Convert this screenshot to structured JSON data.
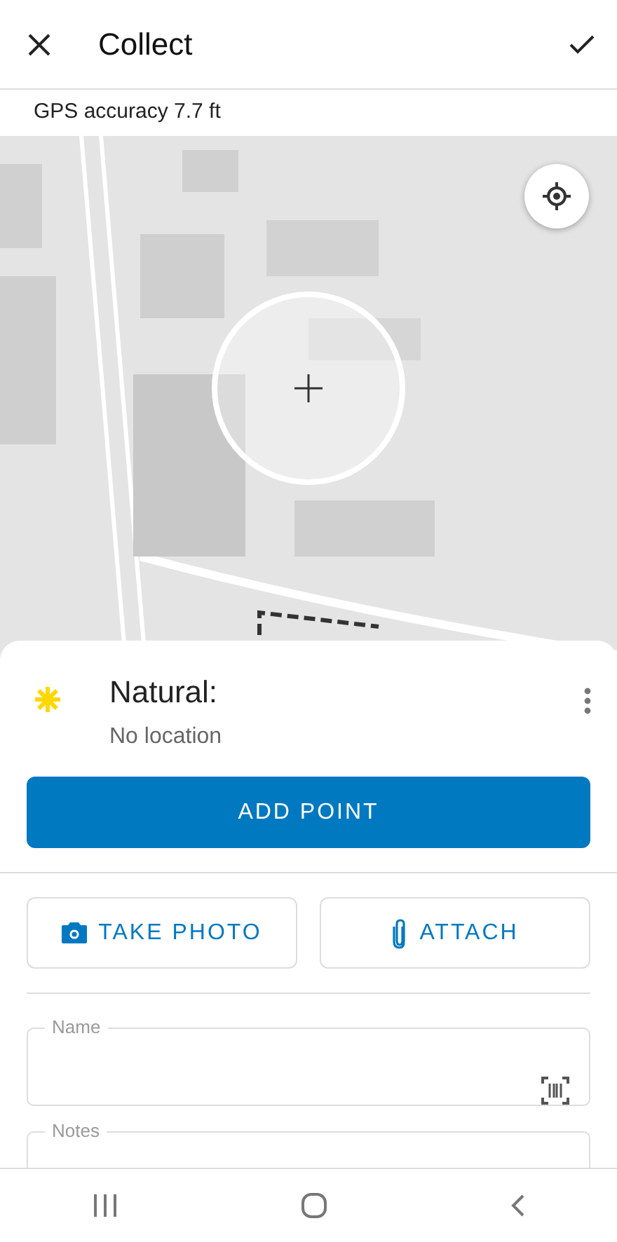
{
  "app_bar": {
    "title": "Collect"
  },
  "gps_status": "GPS accuracy 7.7 ft",
  "feature": {
    "title": "Natural:",
    "subtitle": "No location"
  },
  "primary_action": "ADD POINT",
  "attachment_buttons": [
    {
      "kind": "photo",
      "label": "TAKE PHOTO"
    },
    {
      "kind": "attach",
      "label": "ATTACH"
    }
  ],
  "fields": [
    {
      "label": "Name"
    },
    {
      "label": "Notes"
    }
  ]
}
